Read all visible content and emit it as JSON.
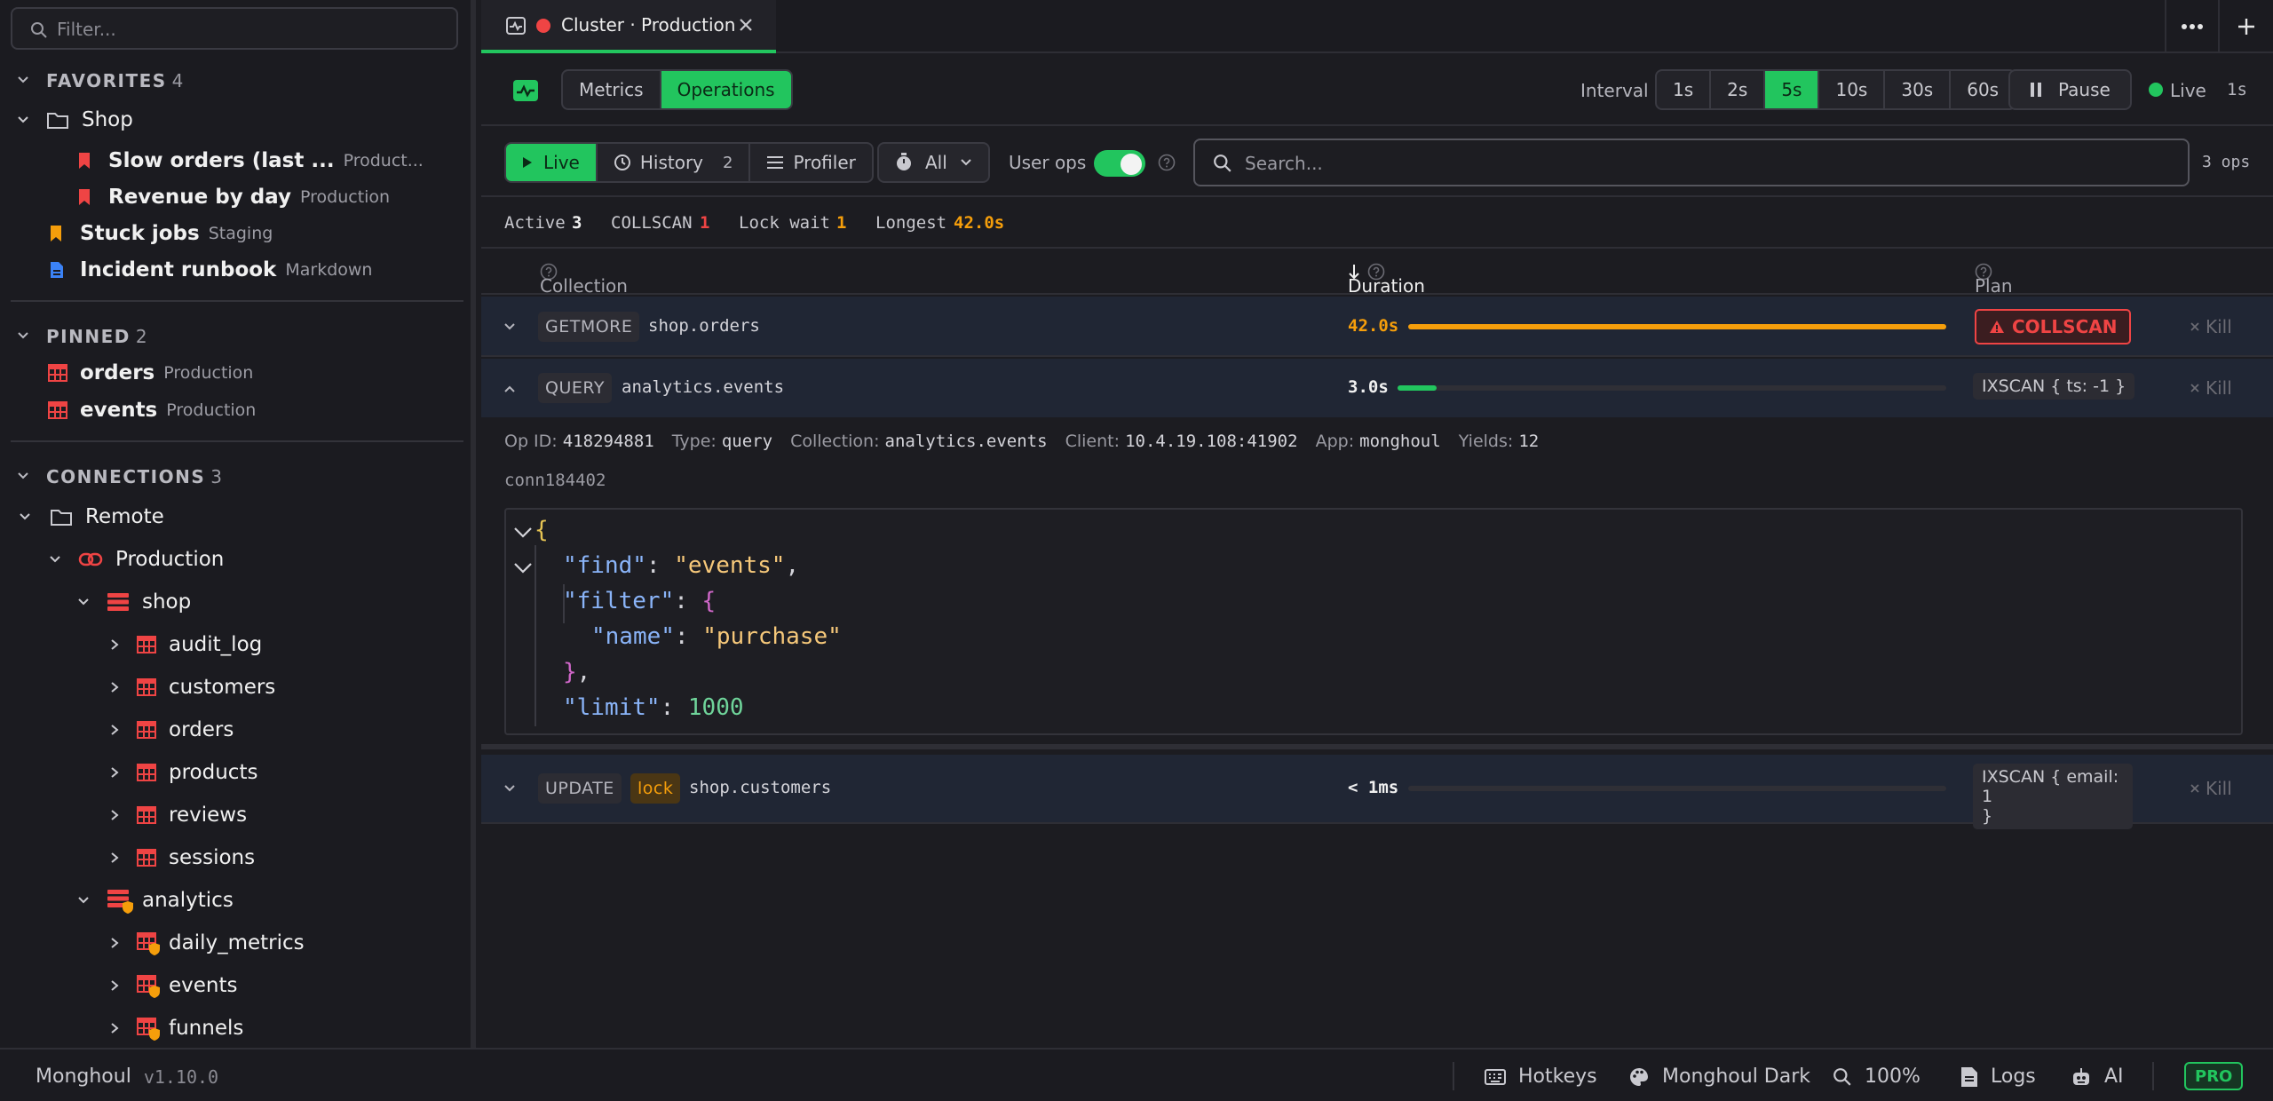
{
  "sidebar": {
    "filter_placeholder": "Filter...",
    "favorites": {
      "title": "FAVORITES",
      "count": "4",
      "folder": "Shop",
      "items": [
        {
          "name": "Slow orders (last ...",
          "sub": "Product..."
        },
        {
          "name": "Revenue by day",
          "sub": "Production"
        }
      ],
      "stuck": {
        "name": "Stuck jobs",
        "sub": "Staging"
      },
      "runbook": {
        "name": "Incident runbook",
        "sub": "Markdown"
      }
    },
    "pinned": {
      "title": "PINNED",
      "count": "2",
      "items": [
        {
          "name": "orders",
          "sub": "Production"
        },
        {
          "name": "events",
          "sub": "Production"
        }
      ]
    },
    "connections": {
      "title": "CONNECTIONS",
      "count": "3",
      "folder": "Remote",
      "connection": "Production",
      "db_shop": "shop",
      "shop_collections": [
        "audit_log",
        "customers",
        "orders",
        "products",
        "reviews",
        "sessions"
      ],
      "db_analytics": "analytics",
      "analytics_collections": [
        "daily_metrics",
        "events",
        "funnels"
      ]
    }
  },
  "tabbar": {
    "tab_label": "Cluster · Production"
  },
  "toolbar": {
    "views": [
      "Metrics",
      "Operations"
    ],
    "interval_label": "Interval",
    "intervals": [
      "1s",
      "2s",
      "5s",
      "10s",
      "30s",
      "60s"
    ],
    "pause_label": "Pause",
    "live_label": "Live",
    "live_value": "1s"
  },
  "modes": {
    "live": "Live",
    "history": "History",
    "history_count": "2",
    "profiler": "Profiler",
    "filter_all": "All",
    "user_ops": "User ops",
    "search_placeholder": "Search...",
    "ops_count": "3 ops"
  },
  "stats": {
    "active_label": "Active",
    "active": "3",
    "collscan_label": "COLLSCAN",
    "collscan": "1",
    "lockwait_label": "Lock wait",
    "lockwait": "1",
    "longest_label": "Longest",
    "longest": "42.0s"
  },
  "table": {
    "headers": {
      "collection": "Collection",
      "duration": "Duration",
      "plan": "Plan"
    },
    "kill_label": "Kill",
    "rows": [
      {
        "type": "GETMORE",
        "collection": "shop.orders",
        "duration": "42.0s",
        "progress": 1.0,
        "plan": "COLLSCAN"
      },
      {
        "type": "QUERY",
        "collection": "analytics.events",
        "duration": "3.0s",
        "progress": 0.071,
        "plan": "IXSCAN { ts: -1 }"
      },
      {
        "type": "UPDATE",
        "lock": "lock",
        "collection": "shop.customers",
        "duration": "< 1ms",
        "progress": 0,
        "plan_line1": "IXSCAN { email: 1",
        "plan_line2": "}"
      }
    ]
  },
  "detail": {
    "opid_label": "Op ID:",
    "opid": "418294881",
    "type_label": "Type:",
    "type": "query",
    "coll_label": "Collection:",
    "coll": "analytics.events",
    "client_label": "Client:",
    "client": "10.4.19.108:41902",
    "app_label": "App:",
    "app": "monghoul",
    "yields_label": "Yields:",
    "yields": "12",
    "conn": "conn184402",
    "code": {
      "open": "{",
      "find_key": "\"find\"",
      "find_val": "\"events\"",
      "filter_key": "\"filter\"",
      "brace_open": "{",
      "name_key": "\"name\"",
      "name_val": "\"purchase\"",
      "brace_close": "}",
      "limit_key": "\"limit\"",
      "limit_val": "1000"
    }
  },
  "statusbar": {
    "app": "Monghoul",
    "version": "v1.10.0",
    "hotkeys": "Hotkeys",
    "theme": "Monghoul Dark",
    "zoom": "100%",
    "logs": "Logs",
    "ai": "AI",
    "pro": "PRO"
  },
  "colors": {
    "accent": "#22c55e",
    "danger": "#ef4444",
    "warning": "#f59e0b"
  }
}
